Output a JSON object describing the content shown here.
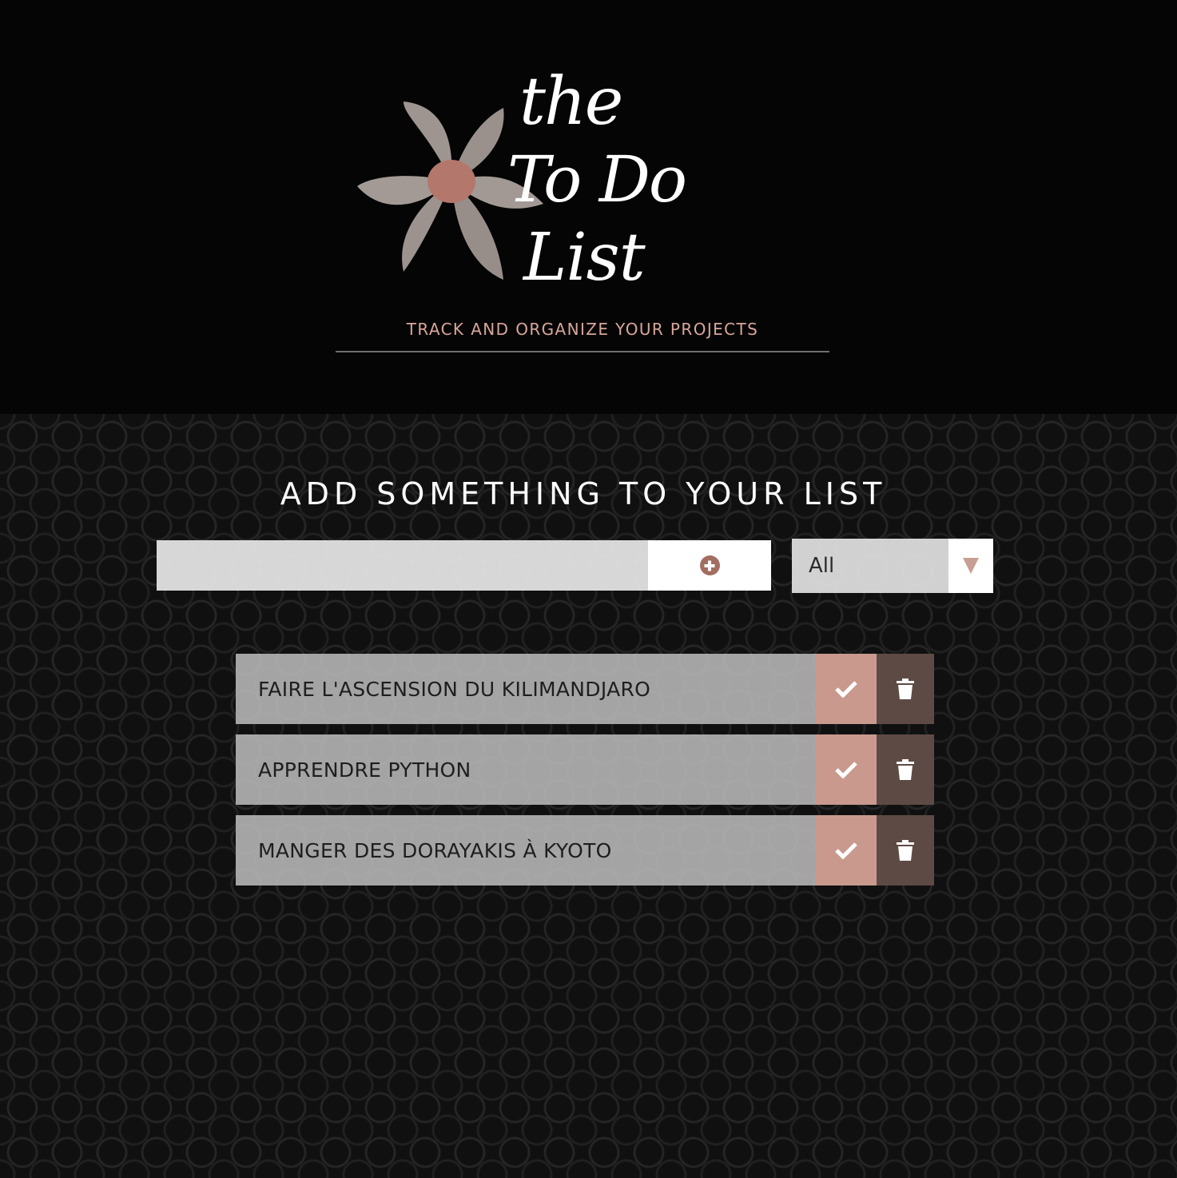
{
  "header": {
    "logo": {
      "line1": "the",
      "line2": "To Do",
      "line3": "List"
    },
    "tagline": "TRACK AND ORGANIZE YOUR PROJECTS"
  },
  "main": {
    "section_title": "ADD SOMETHING TO YOUR LIST",
    "input": {
      "value": "",
      "placeholder": ""
    },
    "add_button_icon": "plus-circle-icon",
    "filter": {
      "selected": "All",
      "icon": "chevron-down-icon"
    },
    "todos": [
      {
        "text": "FAIRE L'ASCENSION DU KILIMANDJARO"
      },
      {
        "text": "APPRENDRE PYTHON"
      },
      {
        "text": "MANGER DES DORAYAKIS À KYOTO"
      }
    ]
  },
  "colors": {
    "background": "#000000",
    "accent_pink": "#c9998e",
    "accent_brown": "#5e4a45",
    "tagline": "#d9a69a",
    "flower": "#9e9591",
    "flower_center": "#b4776c"
  }
}
